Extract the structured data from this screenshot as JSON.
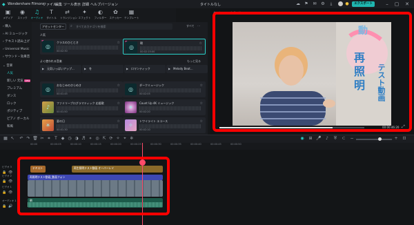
{
  "app": {
    "title": "Wondershare Filmora",
    "project_title": "タイトルなし",
    "menu": [
      "ファイル",
      "編集",
      "ツール",
      "表示",
      "詳細",
      "ヘルプ",
      "バージョン"
    ],
    "export_label": "エクスポート"
  },
  "toolbar": {
    "tools": [
      {
        "icon": "media-icon",
        "glyph": "▣",
        "label": "メディア"
      },
      {
        "icon": "stock-icon",
        "glyph": "◉",
        "label": "ストック"
      },
      {
        "icon": "audio-icon",
        "glyph": "♫",
        "label": "オーディオ"
      },
      {
        "icon": "title-icon",
        "glyph": "T",
        "label": "タイトル"
      },
      {
        "icon": "transition-icon",
        "glyph": "⇄",
        "label": "トランジション"
      },
      {
        "icon": "effect-icon",
        "glyph": "✦",
        "label": "エフェクト"
      },
      {
        "icon": "filter-icon",
        "glyph": "◐",
        "label": "フィルター"
      },
      {
        "icon": "sticker-icon",
        "glyph": "✿",
        "label": "ステッカー"
      },
      {
        "icon": "template-icon",
        "glyph": "▦",
        "label": "テンプレート"
      }
    ]
  },
  "sidebar": {
    "items": [
      {
        "label": "購入"
      },
      {
        "label": "AI ミュージック"
      },
      {
        "label": "テキスト読み上げ"
      },
      {
        "label": "Universal Music"
      },
      {
        "label": "サウンド・効果音"
      },
      {
        "label": "音楽"
      },
      {
        "label": "人気"
      },
      {
        "label": "新しい 元気",
        "badge": "NEW"
      },
      {
        "label": "プレミアム"
      },
      {
        "label": "ダンス"
      },
      {
        "label": "ロック"
      },
      {
        "label": "ポジティブ"
      },
      {
        "label": "ピアノ ボーカル"
      },
      {
        "label": "和風"
      }
    ]
  },
  "library": {
    "asset_chip": "アセットセンター",
    "search_placeholder": "すべてのカテゴリを検索",
    "filter_label": "すべて",
    "section_popular": "人気",
    "cards_top": [
      {
        "name": "クラスのひととき",
        "duration": "00:02:30"
      },
      {
        "name": "朝",
        "duration": "00:02:15:00"
      }
    ],
    "section_recent": "よく使われる音楽",
    "more_label": "もっと見る",
    "recent": [
      {
        "name": "元気いっぱいアップ..."
      },
      {
        "name": "冬"
      },
      {
        "name": "ロマンティック"
      },
      {
        "name": "Melody Beat..."
      }
    ],
    "cards_bottom": [
      {
        "name": "おなじみのきらめき",
        "duration": "00:01:45"
      },
      {
        "name": "ダークミュージック",
        "duration": "00:02:05"
      },
      {
        "name": "ファミリープログラマティック 応援歌",
        "duration": "00:01:50"
      },
      {
        "name": "Count Up 4K ミュージック",
        "duration": "00:02:20"
      },
      {
        "name": "夏の日",
        "duration": "00:01:30"
      },
      {
        "name": "トワイライト エコース",
        "duration": "00:02:10"
      }
    ]
  },
  "preview": {
    "tabs": [
      "タイムライン",
      "プレビュー"
    ],
    "timecode": "00:00:46:20",
    "progress": 0.78,
    "overlay_text": [
      "動",
      "再",
      "照",
      "明",
      "テスト動画"
    ]
  },
  "timeline": {
    "ruler": [
      "00:00",
      "00:00:05",
      "00:00:10",
      "00:00:15",
      "00:00:20",
      "00:00:25",
      "00:00:30",
      "00:00:35",
      "00:00:40",
      "00:00:45",
      "00:00:50"
    ],
    "tracks": [
      {
        "label": "ビデオ 3"
      },
      {
        "label": "ビデオ 2"
      },
      {
        "label": "ビデオ 1"
      },
      {
        "label": "オーディオ 1"
      }
    ],
    "clips": {
      "title_clip": "テキスト",
      "overlay_clip": "再生照明テスト動画 オーバーレイ",
      "video_clip": "再照明テスト動画_動画フォン",
      "audio_clip": "朝"
    }
  }
}
